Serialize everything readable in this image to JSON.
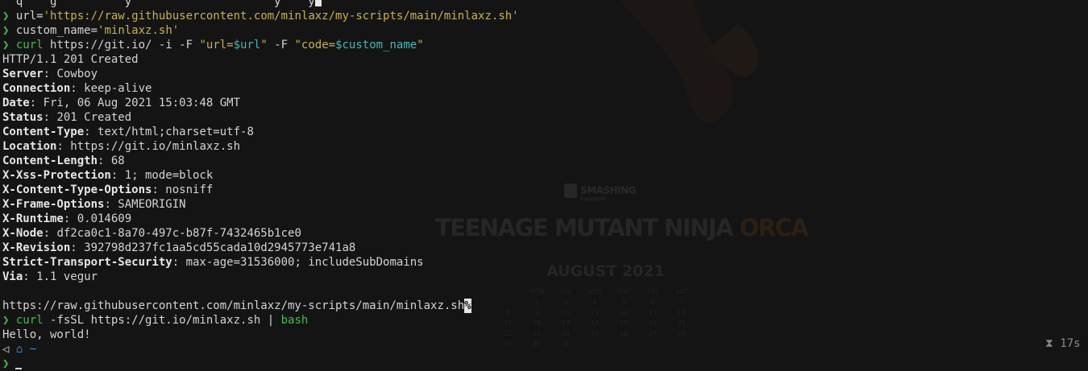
{
  "theme": {
    "background": "#141414",
    "foreground": "#d4d4d4",
    "prompt_green": "#3fbf4a",
    "string_yellow": "#c8b246",
    "variable_cyan": "#3db8b8",
    "icon_blue": "#3b8eea"
  },
  "wallpaper": {
    "logo": "SMASHING",
    "logo_sub": "MAGAZINE",
    "title_part1": "TEENAGE MUTANT NINJA ",
    "title_part2": "ORCA",
    "month": "AUGUST 2021",
    "weekdays": [
      "",
      "MON",
      "TUE",
      "WED",
      "THU",
      "FRI",
      "SAT"
    ],
    "days": [
      "",
      "2",
      "3",
      "4",
      "5",
      "6",
      "7",
      "8",
      "9",
      "10",
      "11",
      "12",
      "13",
      "14",
      "15",
      "16",
      "17",
      "18",
      "19",
      "20",
      "21",
      "22",
      "23",
      "24",
      "25",
      "26",
      "27",
      "28",
      "29",
      "30",
      "31",
      "",
      "",
      "",
      ""
    ]
  },
  "terminal": {
    "prompt_symbol": "❯",
    "line0_partial": "  q    g          y                     y    y",
    "cmd_url": {
      "name": "url=",
      "value": "'https://raw.githubusercontent.com/minlaxz/my-scripts/main/minlaxz.sh'"
    },
    "cmd_custom": {
      "name": "custom_name=",
      "value": "'minlaxz.sh'"
    },
    "cmd_curl": {
      "cmd": "curl",
      "args1": " https://git.io/ -i -F ",
      "q1": "\"url=",
      "v1": "$url",
      "q1e": "\"",
      "args2": " -F ",
      "q2": "\"code=",
      "v2": "$custom_name",
      "q2e": "\""
    },
    "status_line": "HTTP/1.1 201 Created",
    "headers": [
      {
        "key": "Server",
        "value": "Cowboy"
      },
      {
        "key": "Connection",
        "value": "keep-alive"
      },
      {
        "key": "Date",
        "value": "Fri, 06 Aug 2021 15:03:48 GMT"
      },
      {
        "key": "Status",
        "value": "201 Created"
      },
      {
        "key": "Content-Type",
        "value": "text/html;charset=utf-8"
      },
      {
        "key": "Location",
        "value": "https://git.io/minlaxz.sh"
      },
      {
        "key": "Content-Length",
        "value": "68"
      },
      {
        "key": "X-Xss-Protection",
        "value": "1; mode=block"
      },
      {
        "key": "X-Content-Type-Options",
        "value": "nosniff"
      },
      {
        "key": "X-Frame-Options",
        "value": "SAMEORIGIN"
      },
      {
        "key": "X-Runtime",
        "value": "0.014609"
      },
      {
        "key": "X-Node",
        "value": "df2ca0c1-8a70-497c-b87f-7432465b1ce0"
      },
      {
        "key": "X-Revision",
        "value": "392798d237fc1aa5cd55cada10d2945773e741a8"
      },
      {
        "key": "Strict-Transport-Security",
        "value": "max-age=31536000; includeSubDomains"
      },
      {
        "key": "Via",
        "value": "1.1 vegur"
      }
    ],
    "body_output": "https://raw.githubusercontent.com/minlaxz/my-scripts/main/minlaxz.sh",
    "no_newline_mark": "%",
    "cmd_run": {
      "cmd": "curl",
      "args": " -fsSL https://git.io/minlaxz.sh | ",
      "pipe_cmd": "bash"
    },
    "run_output": "Hello, world!",
    "info_prompt": {
      "os_icon": "◁",
      "home_icon": "⌂",
      "path": "~",
      "timer_icon": "⧗",
      "duration": "17s"
    }
  }
}
